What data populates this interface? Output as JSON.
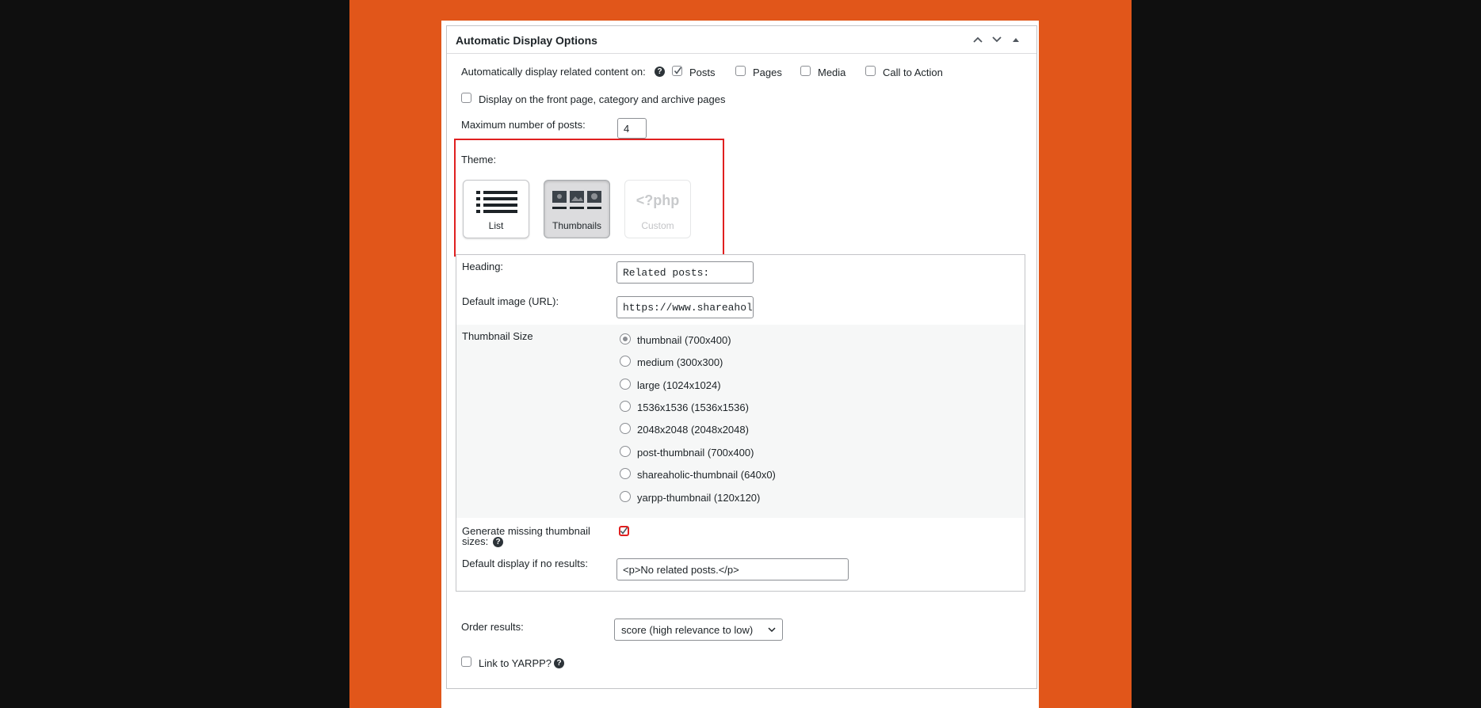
{
  "panel": {
    "title": "Automatic Display Options"
  },
  "auto_display": {
    "label": "Automatically display related content on:",
    "options": [
      {
        "label": "Posts",
        "checked": true
      },
      {
        "label": "Pages",
        "checked": false
      },
      {
        "label": "Media",
        "checked": false
      },
      {
        "label": "Call to Action",
        "checked": false
      }
    ]
  },
  "front_page": {
    "label": "Display on the front page, category and archive pages",
    "checked": false
  },
  "max_posts": {
    "label": "Maximum number of posts:",
    "value": "4"
  },
  "theme": {
    "label": "Theme:",
    "options": [
      {
        "label": "List",
        "selected": false
      },
      {
        "label": "Thumbnails",
        "selected": true
      },
      {
        "label": "Custom",
        "disabled": true,
        "glyph": "<?php"
      }
    ]
  },
  "heading": {
    "label": "Heading:",
    "value": "Related posts:"
  },
  "default_image": {
    "label": "Default image (URL):",
    "value": "https://www.shareaholic.com"
  },
  "thumbnail_size": {
    "label": "Thumbnail Size",
    "options": [
      {
        "label": "thumbnail (700x400)",
        "checked": true
      },
      {
        "label": "medium (300x300)",
        "checked": false
      },
      {
        "label": "large (1024x1024)",
        "checked": false
      },
      {
        "label": "1536x1536 (1536x1536)",
        "checked": false
      },
      {
        "label": "2048x2048 (2048x2048)",
        "checked": false
      },
      {
        "label": "post-thumbnail (700x400)",
        "checked": false
      },
      {
        "label": "shareaholic-thumbnail (640x0)",
        "checked": false
      },
      {
        "label": "yarpp-thumbnail (120x120)",
        "checked": false
      }
    ]
  },
  "generate_missing": {
    "label_line1": "Generate missing thumbnail",
    "label_line2": "sizes:",
    "checked": true
  },
  "no_results": {
    "label": "Default display if no results:",
    "value": "<p>No related posts.</p>"
  },
  "order_results": {
    "label": "Order results:",
    "value": "score (high relevance to low)"
  },
  "link_yarpp": {
    "label": "Link to YARPP?",
    "checked": false
  },
  "help_glyph": "?",
  "colors": {
    "background_orange": "#e1561a",
    "highlight_red": "#e02020"
  }
}
